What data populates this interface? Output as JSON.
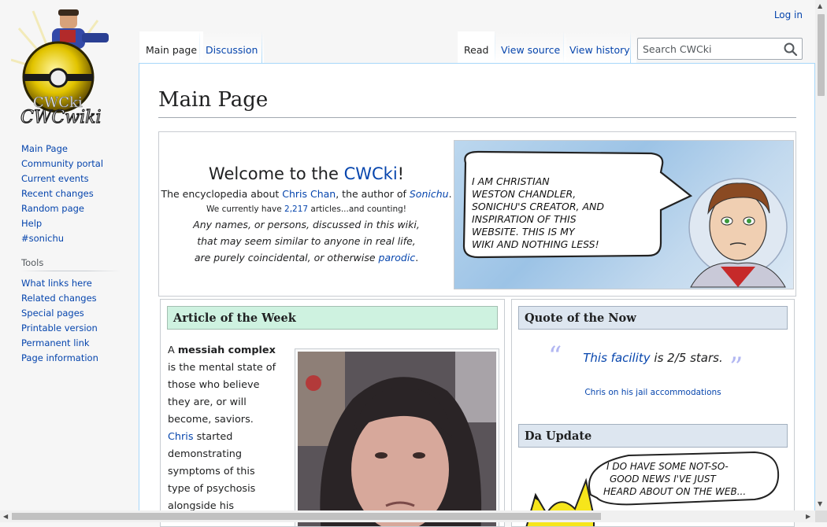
{
  "site": {
    "logo_text": "CWCki CWCwiki"
  },
  "personal_tools": {
    "login": "Log in"
  },
  "namespace_tabs": {
    "main_page": "Main page",
    "discussion": "Discussion"
  },
  "view_tabs": {
    "read": "Read",
    "view_source": "View source",
    "view_history": "View history"
  },
  "search": {
    "placeholder": "Search CWCki",
    "button_icon": "search-icon"
  },
  "sidebar": {
    "navigation": [
      "Main Page",
      "Community portal",
      "Current events",
      "Recent changes",
      "Random page",
      "Help",
      "#sonichu"
    ],
    "tools_heading": "Tools",
    "tools": [
      "What links here",
      "Related changes",
      "Special pages",
      "Printable version",
      "Permanent link",
      "Page information"
    ]
  },
  "page": {
    "title": "Main Page"
  },
  "welcome": {
    "title_prefix": "Welcome to the ",
    "title_link": "CWCki",
    "title_suffix": "!",
    "l1_a": "The encyclopedia about ",
    "l1_link1": "Chris Chan",
    "l1_b": ", the author of ",
    "l1_link2": "Sonichu",
    "l1_c": ".",
    "l2_a": "We currently have ",
    "l2_count": "2,217",
    "l2_b": " articles...and counting!",
    "l3": "Any names, or persons, discussed in this wiki,",
    "l4": "that may seem similar to anyone in real life,",
    "l5_a": "are purely coincidental, or otherwise ",
    "l5_link": "parodic",
    "l5_b": ".",
    "comic_speech": [
      "I AM CHRISTIAN",
      "WESTON CHANDLER,",
      "SONICHU'S CREATOR, AND",
      "INSPIRATION OF THIS",
      "WEBSITE. THIS IS MY",
      "WIKI AND NOTHING LESS!"
    ]
  },
  "article_of_week": {
    "heading": "Article of the Week",
    "t_a": "A ",
    "t_bold": "messiah complex",
    "t_b": " is the mental state of those who believe they are, or will become, saviors.",
    "t_link": "Chris",
    "t_c": " started demonstrating symptoms of this type of psychosis alongside his"
  },
  "quote": {
    "heading": "Quote of the Now",
    "open_mark": "“",
    "close_mark": "”",
    "link": "This facility",
    "rest": " is 2/5 stars.",
    "attribution": "Chris on his jail accommodations"
  },
  "update": {
    "heading": "Da Update",
    "comic_speech": [
      "I DO HAVE SOME NOT-SO-",
      "GOOD NEWS I'VE JUST",
      "HEARD ABOUT ON THE WEB..."
    ]
  },
  "colors": {
    "link": "#0645ad",
    "aotw_head_bg": "#cef2e0",
    "qotn_head_bg": "#dde6f0",
    "quote_marks": "#b2b7f2"
  }
}
